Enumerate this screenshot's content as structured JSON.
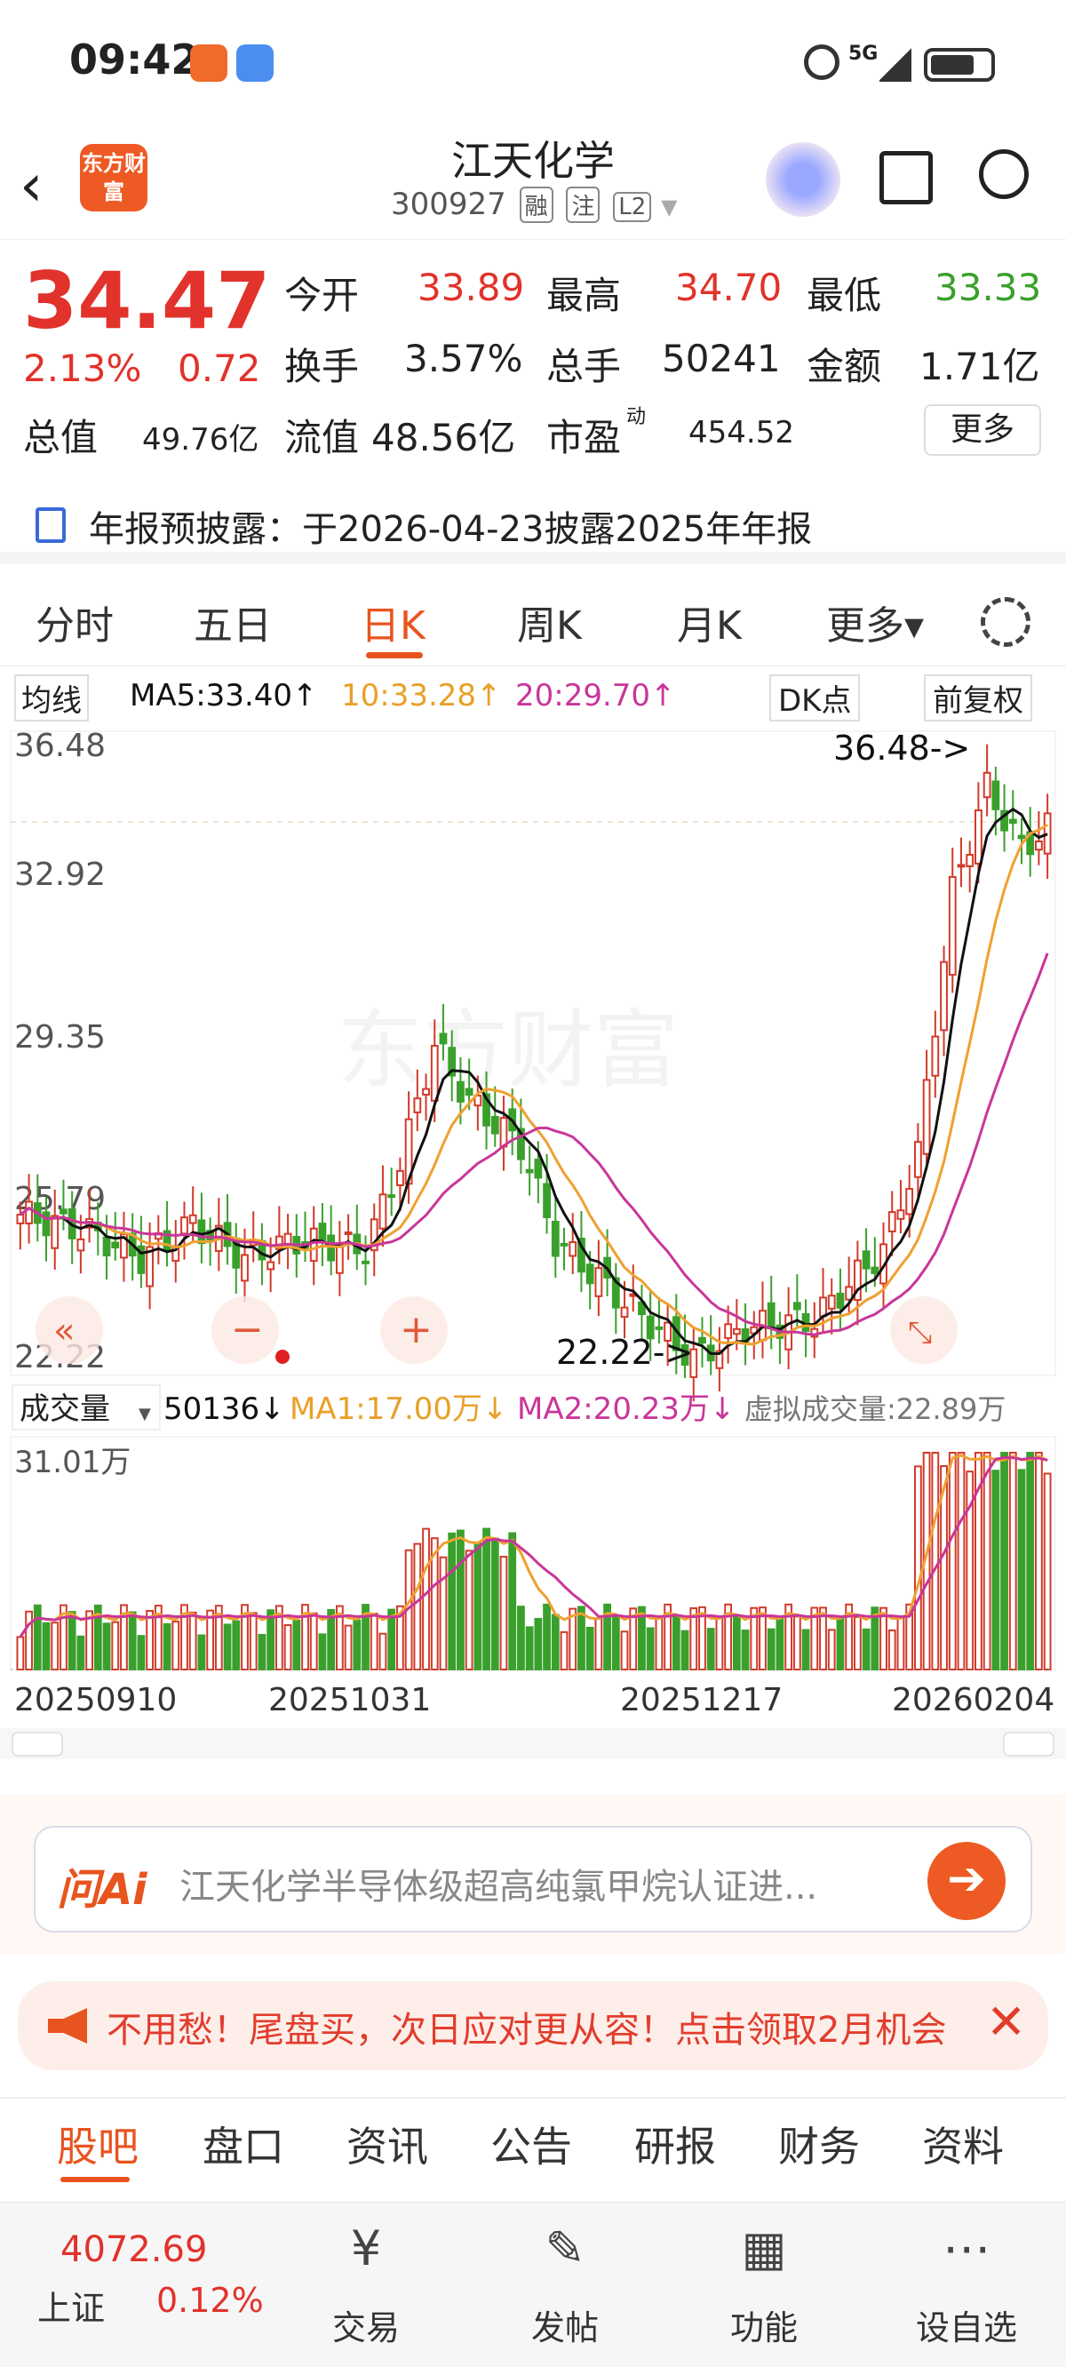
{
  "status_bar": {
    "time": "09:42",
    "network": "5G"
  },
  "header": {
    "stock_name": "江天化学",
    "stock_code": "300927",
    "tags": [
      "融",
      "注",
      "L2"
    ],
    "logo_text": "东方财富"
  },
  "quote": {
    "price": "34.47",
    "change_pct": "2.13%",
    "change": "0.72",
    "open_label": "今开",
    "open": "33.89",
    "high_label": "最高",
    "high": "34.70",
    "low_label": "最低",
    "low": "33.33",
    "turnover_label": "换手",
    "turnover": "3.57%",
    "volume_label": "总手",
    "volume": "50241",
    "amount_label": "金额",
    "amount": "1.71亿",
    "mktcap_label": "总值",
    "mktcap": "49.76亿",
    "float_label": "流值",
    "float": "48.56亿",
    "pe_label": "市盈",
    "pe_sup": "动",
    "pe": "454.52",
    "more": "更多"
  },
  "announcement": "年报预披露：于2026-04-23披露2025年年报",
  "period_tabs": [
    "分时",
    "五日",
    "日K",
    "周K",
    "月K",
    "更多▾"
  ],
  "active_tab": "日K",
  "ma_bar": {
    "selector": "均线",
    "ma5": "MA5:33.40↑",
    "ma10": "10:33.28↑",
    "ma20": "20:29.70↑",
    "dk": "DK点",
    "adjust": "前复权"
  },
  "vol_bar": {
    "selector": "成交量",
    "vol": "50136↓",
    "ma1": "MA1:17.00万↓",
    "ma2": "MA2:20.23万↓",
    "virtual": "虚拟成交量:22.89万"
  },
  "chart_data": {
    "type": "candlestick",
    "y_labels": [
      "36.48",
      "32.92",
      "29.35",
      "25.79",
      "22.22"
    ],
    "max_annotation": "36.48->",
    "min_annotation": "22.22->",
    "volume_max_label": "31.01万",
    "dates": [
      "20250910",
      "20251031",
      "20251217",
      "20260204"
    ],
    "watermark": "东方财富",
    "colors": {
      "up": "#d23a2a",
      "down": "#3aa02c",
      "ma5": "#111111",
      "ma10": "#f0a030",
      "ma20": "#c9369a"
    }
  },
  "ai_box": {
    "brand": "问Ai",
    "text": "江天化学半导体级超高纯氯甲烷认证进..."
  },
  "notice": {
    "text": "不用愁！尾盘买，次日应对更从容！点击领取2月机会"
  },
  "bottom_tabs": [
    "股吧",
    "盘口",
    "资讯",
    "公告",
    "研报",
    "财务",
    "资料"
  ],
  "dock": {
    "index_value": "4072.69",
    "index_name": "上证",
    "index_pct": "0.12%",
    "items": [
      "交易",
      "发帖",
      "功能",
      "设自选"
    ]
  }
}
